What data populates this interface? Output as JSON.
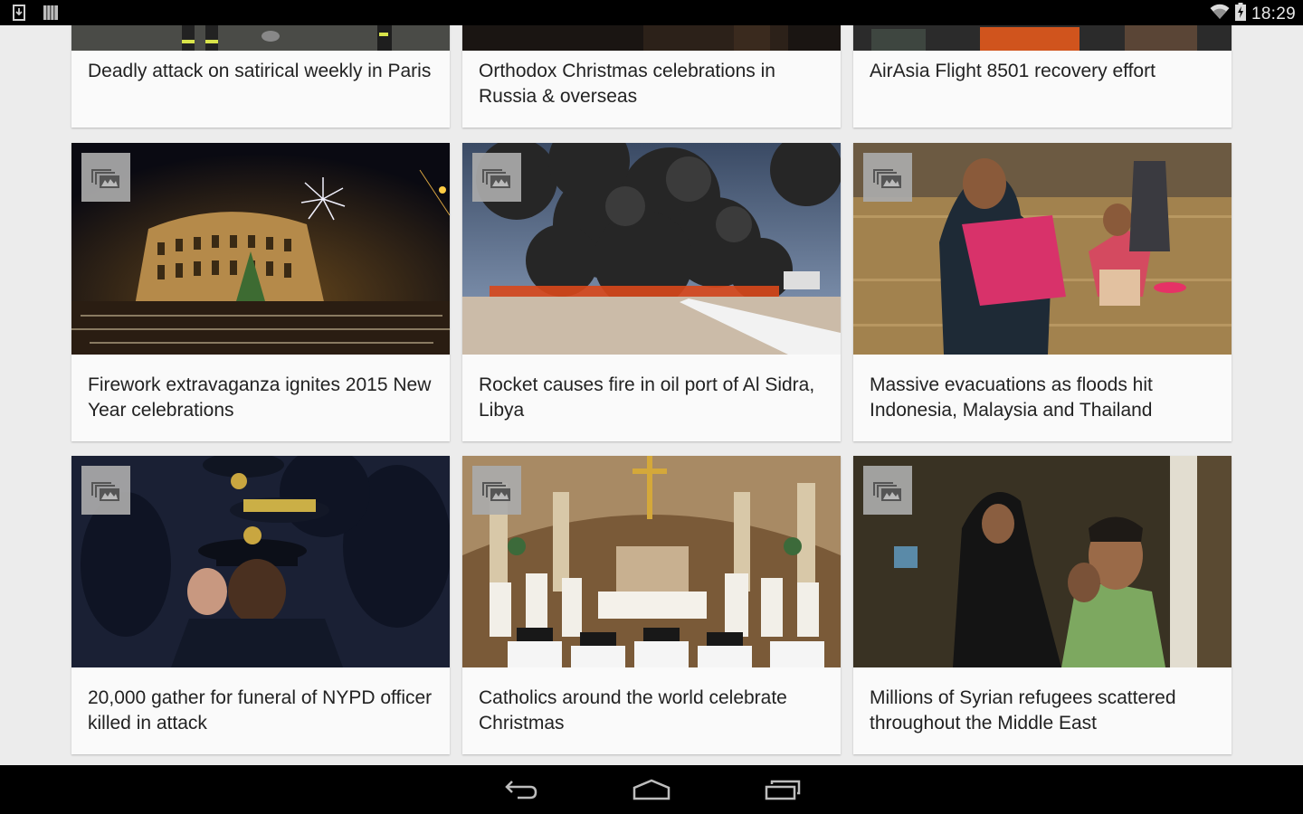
{
  "status_bar": {
    "left_icons": [
      "download-notification-icon",
      "barcode-notification-icon"
    ],
    "right_icons": [
      "wifi-icon",
      "battery-charging-icon"
    ],
    "time": "18:29"
  },
  "cards": [
    {
      "title": "Deadly attack on satirical weekly in Paris",
      "has_gallery": false,
      "image": "firefighters-street"
    },
    {
      "title": "Orthodox Christmas celebrations in Russia & overseas",
      "has_gallery": false,
      "image": "dark-scene"
    },
    {
      "title": "AirAsia Flight 8501 recovery effort",
      "has_gallery": false,
      "image": "recovery-crew"
    },
    {
      "title": "Firework extravaganza ignites 2015 New Year celebrations",
      "has_gallery": true,
      "image": "colosseum-fireworks"
    },
    {
      "title": "Rocket causes fire in oil port of Al Sidra, Libya",
      "has_gallery": true,
      "image": "oil-port-smoke"
    },
    {
      "title": "Massive evacuations as floods hit Indonesia, Malaysia and Thailand",
      "has_gallery": true,
      "image": "flood-evacuation"
    },
    {
      "title": "20,000 gather for funeral of NYPD officer killed in attack",
      "has_gallery": true,
      "image": "nypd-officers"
    },
    {
      "title": "Catholics around the world celebrate Christmas",
      "has_gallery": true,
      "image": "church-mass"
    },
    {
      "title": "Millions of Syrian refugees scattered throughout the Middle East",
      "has_gallery": true,
      "image": "refugees-tent"
    }
  ],
  "nav_bar": {
    "buttons": [
      "back",
      "home",
      "recent-apps"
    ]
  }
}
